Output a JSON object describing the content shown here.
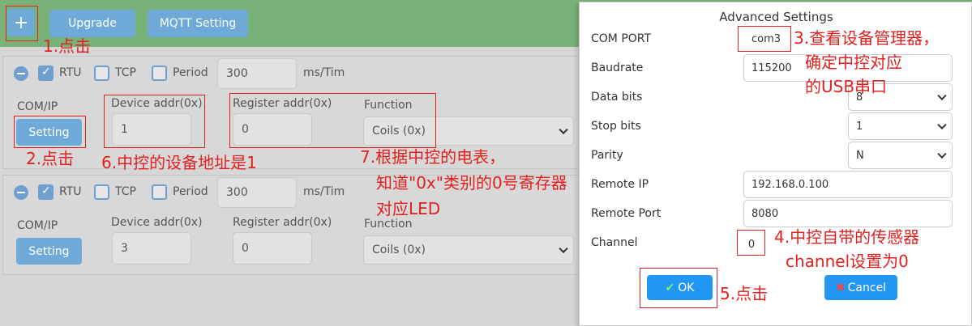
{
  "toolbar": {
    "add_label": "+",
    "upgrade_label": "Upgrade",
    "mqtt_label": "MQTT Setting"
  },
  "rows": [
    {
      "rtu": "RTU",
      "tcp": "TCP",
      "period": "Period",
      "period_value": "300",
      "unit": "ms/Tim",
      "comip": "COM/IP",
      "setting": "Setting",
      "device_label": "Device addr(0x)",
      "device_value": "1",
      "register_label": "Register addr(0x)",
      "register_value": "0",
      "function_label": "Function",
      "function_value": "Coils (0x)"
    },
    {
      "rtu": "RTU",
      "tcp": "TCP",
      "period": "Period",
      "period_value": "300",
      "unit": "ms/Tim",
      "comip": "COM/IP",
      "setting": "Setting",
      "device_label": "Device addr(0x)",
      "device_value": "3",
      "register_label": "Register addr(0x)",
      "register_value": "0",
      "function_label": "Function",
      "function_value": "Coils (0x)"
    }
  ],
  "dialog": {
    "title": "Advanced Settings",
    "com_port_label": "COM PORT",
    "com_port_value": "com3",
    "baudrate_label": "Baudrate",
    "baudrate_value": "115200",
    "databits_label": "Data bits",
    "databits_value": "8",
    "stopbits_label": "Stop bits",
    "stopbits_value": "1",
    "parity_label": "Parity",
    "parity_value": "N",
    "remote_ip_label": "Remote IP",
    "remote_ip_value": "192.168.0.100",
    "remote_port_label": "Remote Port",
    "remote_port_value": "8080",
    "channel_label": "Channel",
    "channel_value": "0",
    "ok_label": "OK",
    "cancel_label": "Cancel"
  },
  "annotations": {
    "a1": "1.点击",
    "a2": "2.点击",
    "a3_l1": "3.查看设备管理器，",
    "a3_l2": "确定中控对应",
    "a3_l3": "的USB串口",
    "a4_l1": "4.中控自带的传感器",
    "a4_l2": "channel设置为0",
    "a5": "5.点击",
    "a6": "6.中控的设备地址是1",
    "a7_l1": "7.根据中控的电表，",
    "a7_l2": "知道\"0x\"类别的0号寄存器",
    "a7_l3": "对应LED"
  },
  "colors": {
    "topbar": "#79b278",
    "button": "#6ea9d8",
    "annotation": "#e32020",
    "ok": "#2196f3"
  }
}
